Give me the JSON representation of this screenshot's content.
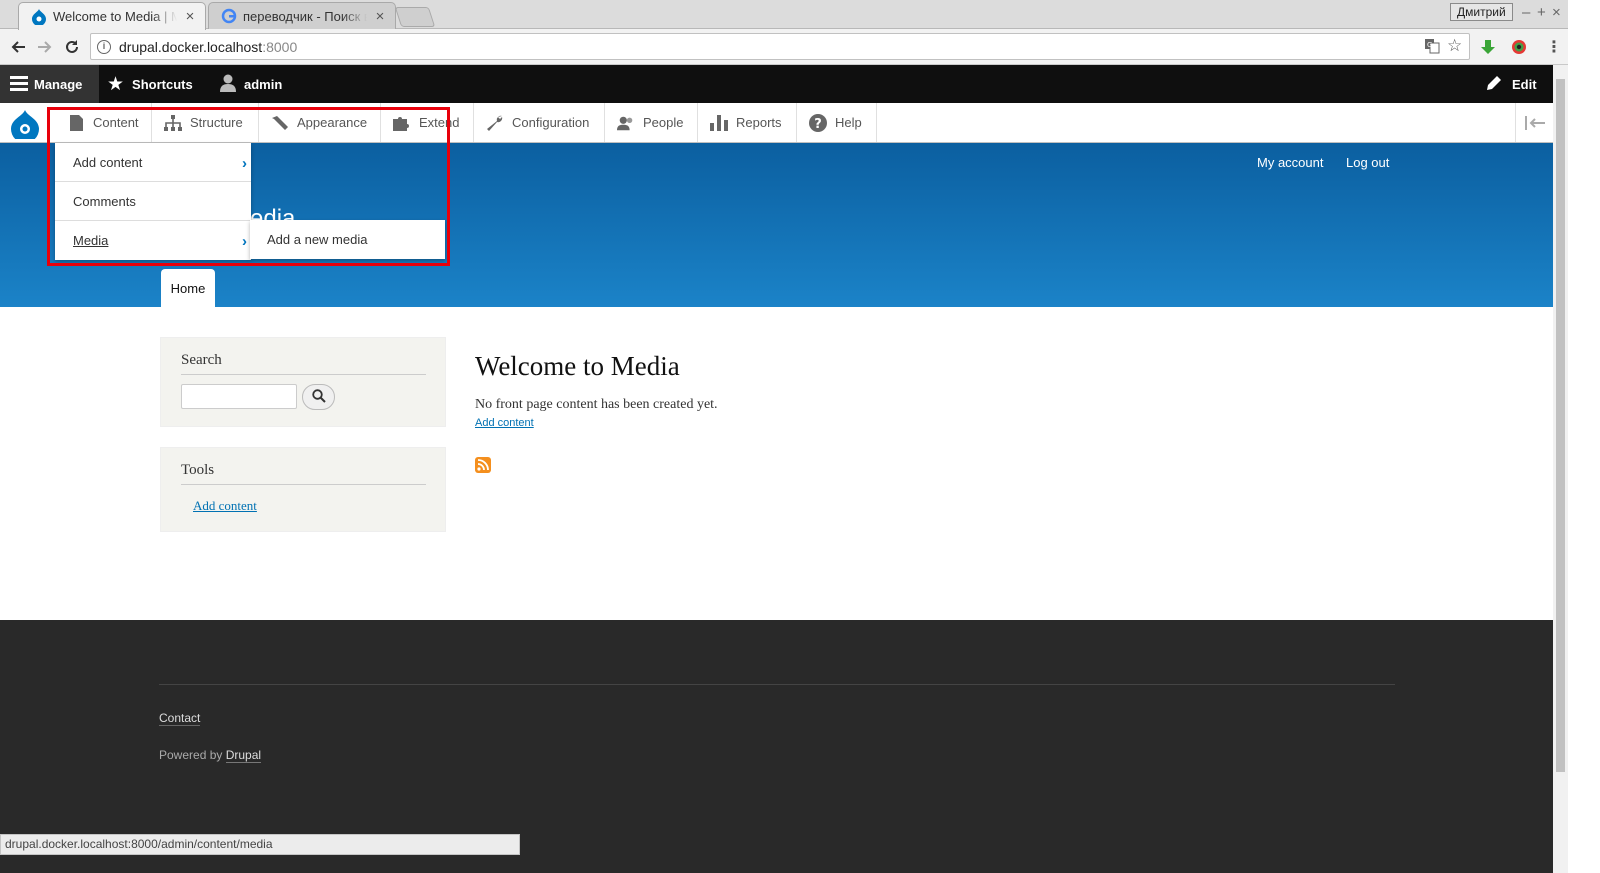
{
  "browser": {
    "tabs": [
      {
        "title": "Welcome to Media | Me"
      },
      {
        "title": "переводчик - Поиск в"
      }
    ],
    "profile_name": "Дмитрий",
    "url_host": "drupal.docker.localhost",
    "url_port": ":8000",
    "status_url": "drupal.docker.localhost:8000/admin/content/media"
  },
  "admin_toolbar": {
    "manage": "Manage",
    "shortcuts": "Shortcuts",
    "user": "admin",
    "edit": "Edit"
  },
  "tray": {
    "items": [
      "Content",
      "Structure",
      "Appearance",
      "Extend",
      "Configuration",
      "People",
      "Reports",
      "Help"
    ]
  },
  "content_menu": {
    "items": [
      "Add content",
      "Comments",
      "Media"
    ],
    "media_submenu": [
      "Add a new media"
    ]
  },
  "secondary_menu": [
    "My account",
    "Log out"
  ],
  "site": {
    "name_fragment": "edia",
    "home_tab": "Home"
  },
  "sidebar": {
    "search_title": "Search",
    "tools_title": "Tools",
    "tools_link": "Add content"
  },
  "main": {
    "title": "Welcome to Media",
    "message": "No front page content has been created yet.",
    "add_link": "Add content"
  },
  "footer": {
    "contact": "Contact",
    "powered_prefix": "Powered by ",
    "powered_link": "Drupal"
  },
  "colors": {
    "hero_top": "#0b5fa0",
    "hero_bottom": "#1b83c8",
    "highlight": "#e8000b",
    "link": "#0071b3"
  }
}
